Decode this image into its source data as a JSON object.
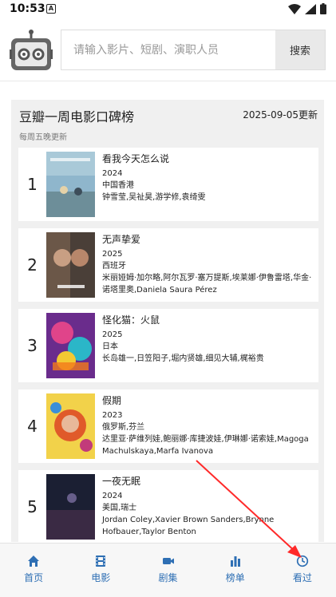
{
  "status": {
    "time": "10:53",
    "notification_letter": "A"
  },
  "search": {
    "placeholder": "请输入影片、短剧、演职人员",
    "button_label": "搜索"
  },
  "chart_panel": {
    "title": "豆瓣一周电影口碑榜",
    "date": "2025-09-05更新",
    "subtitle": "每周五晚更新"
  },
  "movies": [
    {
      "rank": "1",
      "title": "看我今天怎么说",
      "year": "2024",
      "region": "中国香港",
      "cast": "钟雪莹,吴祉昊,游学修,袁绮雯"
    },
    {
      "rank": "2",
      "title": "无声挚爱",
      "year": "2025",
      "region": "西班牙",
      "cast": "米丽娅姆·加尔略,阿尔瓦罗·塞万提斯,埃莱娜·伊鲁雷塔,华金·诺塔里奥,Daniela Saura Pérez"
    },
    {
      "rank": "3",
      "title": "怪化猫：火鼠",
      "year": "2025",
      "region": "日本",
      "cast": "长岛雄一,日笠阳子,堀内贤雄,细见大辅,梶裕贵"
    },
    {
      "rank": "4",
      "title": "假期",
      "year": "2023",
      "region": "俄罗斯,芬兰",
      "cast": "达里亚·萨维列娃,鲍丽娜·库捷波娃,伊琳娜·诺索娃,Magoga Machulskaya,Marfa Ivanova"
    },
    {
      "rank": "5",
      "title": "一夜无眠",
      "year": "2024",
      "region": "美国,瑞士",
      "cast": "Jordan Coley,Xavier Brown Sanders,Brynne Hofbauer,Taylor Benton"
    }
  ],
  "bottom_nav": [
    {
      "label": "首页",
      "icon": "home-icon"
    },
    {
      "label": "电影",
      "icon": "film-icon"
    },
    {
      "label": "剧集",
      "icon": "video-camera-icon"
    },
    {
      "label": "榜单",
      "icon": "bar-chart-icon"
    },
    {
      "label": "看过",
      "icon": "clock-icon"
    }
  ],
  "colors": {
    "accent": "#2e6fb4",
    "annotation_arrow": "#ff2a2a",
    "panel_bg": "#f0f0f0"
  }
}
